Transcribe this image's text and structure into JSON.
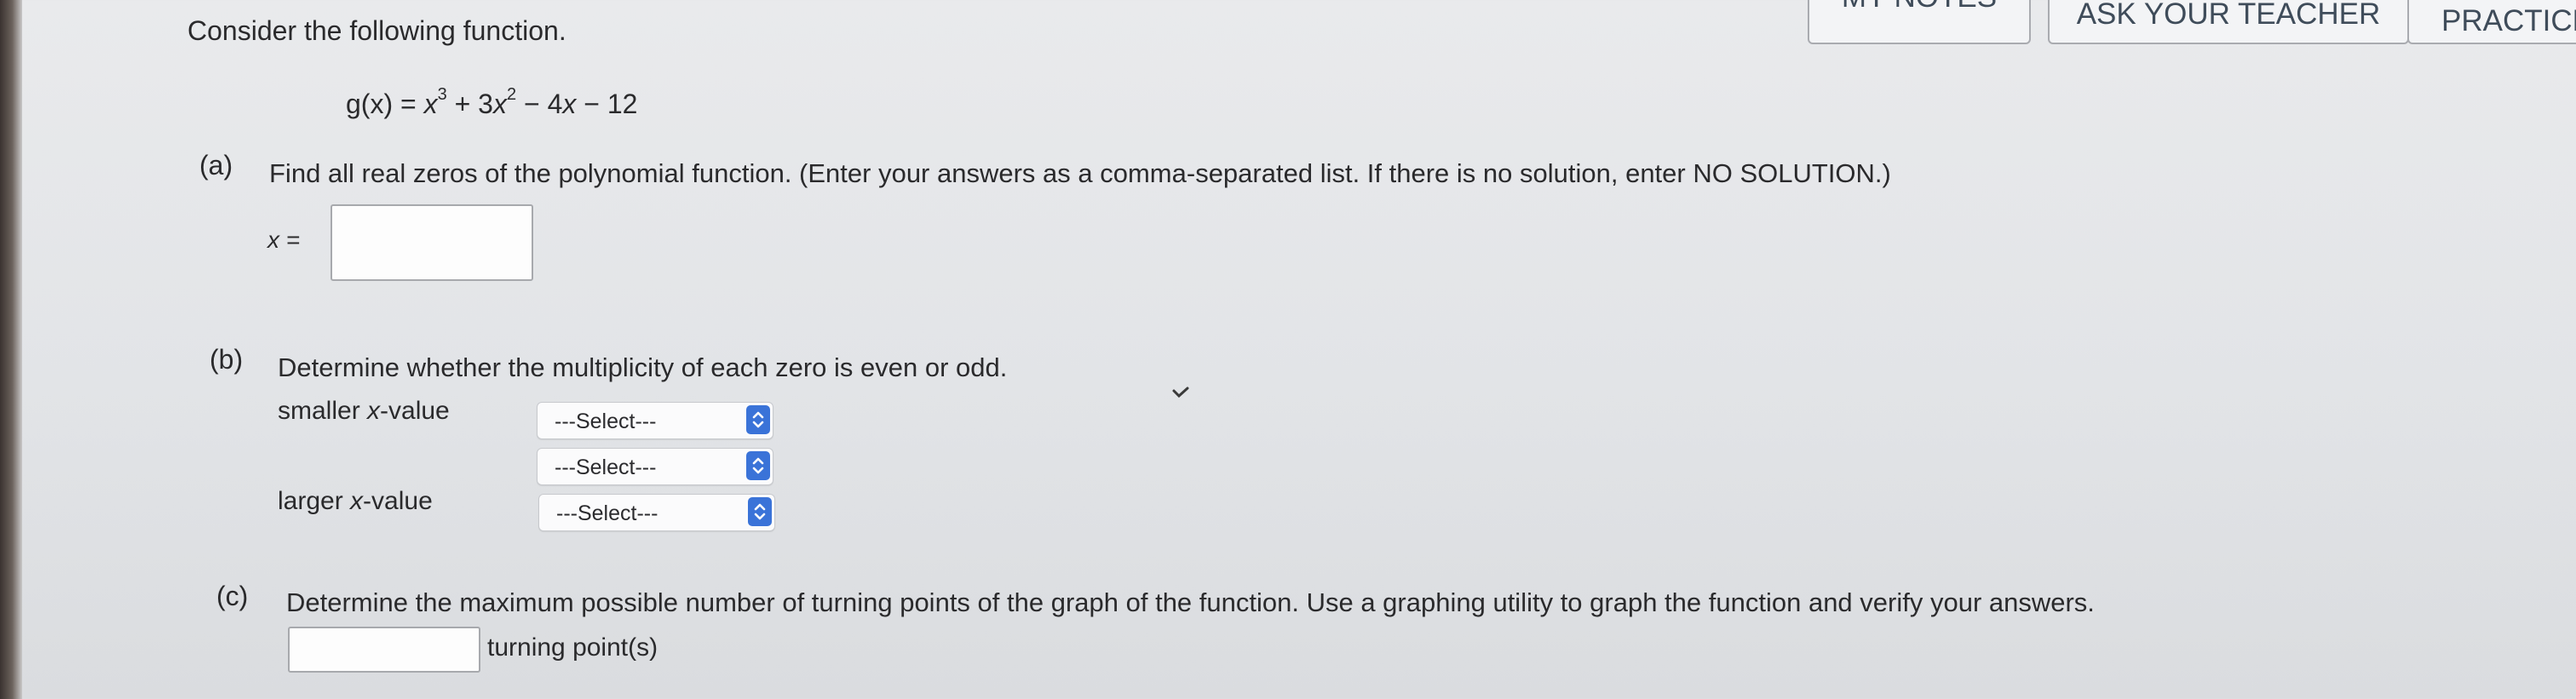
{
  "header": {
    "notes_label": "MY NOTES",
    "ask_label": "ASK YOUR TEACHER",
    "practice_label": "PRACTICE"
  },
  "problem": {
    "intro": "Consider the following function.",
    "function": {
      "lhs": "g(x) = ",
      "t1_base": "x",
      "t1_exp": "3",
      "t2_prefix": " + 3",
      "t2_base": "x",
      "t2_exp": "2",
      "t3_prefix": " − 4",
      "t3_base": "x",
      "t4": " − 12"
    }
  },
  "part_a": {
    "label": "(a)",
    "question": "Find all real zeros of the polynomial function. (Enter your answers as a comma-separated list. If there is no solution, enter NO SOLUTION.)",
    "answer_prefix": "x =",
    "answer_value": ""
  },
  "part_b": {
    "label": "(b)",
    "question": "Determine whether the multiplicity of each zero is even or odd.",
    "rows": [
      {
        "label_prefix": "smaller ",
        "label_var": "x",
        "label_suffix": "-value",
        "selected": "---Select---"
      },
      {
        "label_prefix": "",
        "label_var": "",
        "label_suffix": "",
        "selected": "---Select---"
      },
      {
        "label_prefix": "larger ",
        "label_var": "x",
        "label_suffix": "-value",
        "selected": "---Select---"
      }
    ]
  },
  "part_c": {
    "label": "(c)",
    "question": "Determine the maximum possible number of turning points of the graph of the function. Use a graphing utility to graph the function and verify your answers.",
    "answer_value": "",
    "answer_suffix": "turning point(s)"
  }
}
